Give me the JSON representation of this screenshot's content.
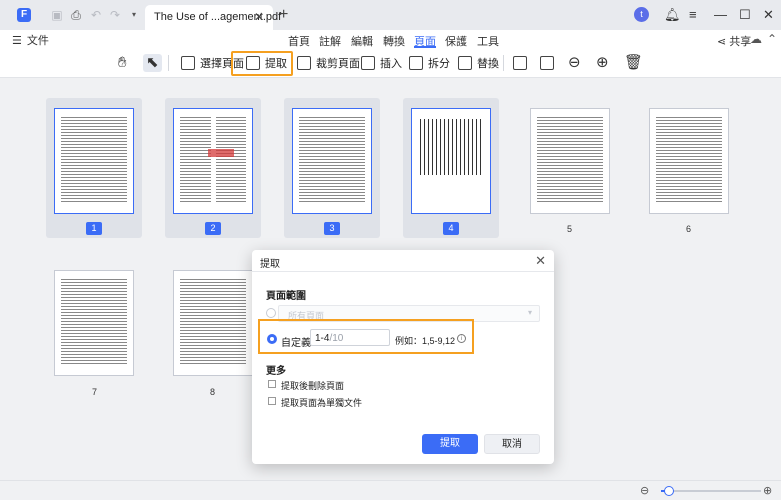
{
  "titlebar": {
    "app_logo": "F",
    "tab_title": "The Use of ...agement.pdf",
    "avatar_letter": "t"
  },
  "menubar": {
    "file_label": "文件",
    "tabs": [
      "首頁",
      "註解",
      "編輯",
      "轉換",
      "頁面",
      "保護",
      "工具"
    ],
    "active_tab": "頁面",
    "share_label": "共享"
  },
  "toolbar": {
    "select_pages_label": "選擇頁面",
    "extract_label": "提取",
    "crop_label": "裁剪頁面",
    "insert_label": "插入",
    "split_label": "拆分",
    "replace_label": "替換"
  },
  "pages": [
    {
      "number": "1",
      "selected": true
    },
    {
      "number": "2",
      "selected": true
    },
    {
      "number": "3",
      "selected": true
    },
    {
      "number": "4",
      "selected": true
    },
    {
      "number": "5",
      "selected": false
    },
    {
      "number": "6",
      "selected": false
    },
    {
      "number": "7",
      "selected": false
    },
    {
      "number": "8",
      "selected": false
    }
  ],
  "dialog": {
    "title": "提取",
    "page_range_heading": "頁面範圍",
    "all_pages_label": "所有頁面",
    "custom_label": "自定義",
    "range_value": "1-4",
    "range_total": "/10",
    "example_label": "例如：1,5-9,12",
    "more_heading": "更多",
    "delete_after_extract_label": "提取後刪除頁面",
    "extract_separate_files_label": "提取頁面為單獨文件",
    "extract_button": "提取",
    "cancel_button": "取消"
  },
  "statusbar": {
    "zoom_fraction": 0.08
  },
  "colors": {
    "accent": "#3b6cf6",
    "highlight": "#f5a020"
  }
}
